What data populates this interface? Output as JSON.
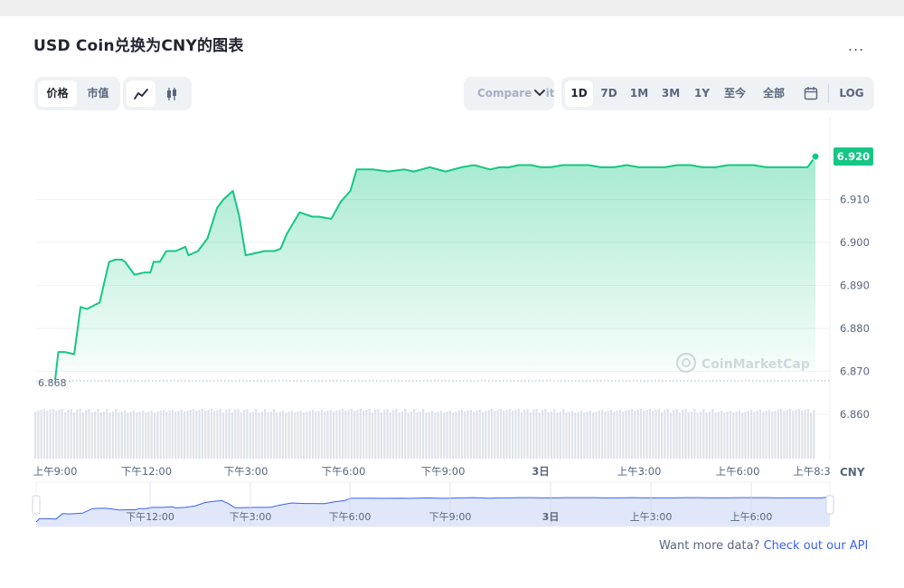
{
  "title": "USD Coin兑换为CNY的图表",
  "more_label": "...",
  "toolbar": {
    "metric_tabs": [
      "价格",
      "市值"
    ],
    "chart_type_icons": [
      "line-chart-icon",
      "candlestick-icon"
    ],
    "compare_label": "Compare with",
    "range_tabs": [
      "1D",
      "7D",
      "1M",
      "3M",
      "1Y",
      "至今",
      "全部"
    ],
    "active_range": "1D",
    "calendar_icon": "calendar-icon",
    "log_label": "LOG"
  },
  "watermark": "CoinMarketCap",
  "footer": {
    "prefix": "Want more data? ",
    "link": "Check out our API"
  },
  "colors": {
    "line": "#16c784",
    "navigator_line": "#3861fb",
    "accent": "#3861fb"
  },
  "chart_data": {
    "type": "area",
    "currency": "CNY",
    "yticks": [
      "6.920",
      "6.910",
      "6.900",
      "6.890",
      "6.880",
      "6.870",
      "6.860"
    ],
    "ylim": [
      6.855,
      6.925
    ],
    "current_value": "6.920",
    "open_value": "6.868",
    "xticks": [
      "上午9:00",
      "下午12:00",
      "下午3:00",
      "下午6:00",
      "下午9:00",
      "3日",
      "上午3:00",
      "上午6:00",
      "上午8:3"
    ],
    "navigator_xticks": [
      "下午12:00",
      "下午3:00",
      "下午6:00",
      "下午9:00",
      "3日",
      "上午3:00",
      "上午6:00"
    ],
    "x_hours": [
      0,
      0.1,
      0.3,
      0.6,
      0.8,
      1.0,
      1.4,
      1.7,
      1.9,
      2.1,
      2.2,
      2.5,
      2.8,
      3.0,
      3.1,
      3.3,
      3.5,
      3.8,
      4.1,
      4.2,
      4.5,
      4.8,
      5.1,
      5.3,
      5.6,
      5.8,
      6.0,
      6.3,
      6.6,
      6.9,
      7.1,
      7.3,
      7.7,
      8.1,
      8.3,
      8.7,
      9.0,
      9.3,
      9.5,
      10.0,
      10.5,
      11.0,
      11.3,
      11.8,
      12.3,
      12.8,
      13.2,
      13.7,
      14.0,
      14.3,
      14.6,
      15.0,
      15.3,
      15.6,
      16.0,
      16.4,
      16.8,
      17.2,
      17.6,
      18.0,
      18.4,
      18.8,
      19.2,
      19.6,
      20.0,
      20.4,
      20.8,
      21.2,
      21.6,
      22.0,
      22.4,
      22.8,
      23.2,
      23.5,
      23.7,
      23.95
    ],
    "prices": [
      6.868,
      6.8745,
      6.8745,
      6.874,
      6.885,
      6.8845,
      6.886,
      6.8955,
      6.896,
      6.896,
      6.8955,
      6.8925,
      6.893,
      6.893,
      6.8955,
      6.8955,
      6.898,
      6.898,
      6.899,
      6.897,
      6.898,
      6.901,
      6.908,
      6.91,
      6.912,
      6.906,
      6.897,
      6.8975,
      6.898,
      6.898,
      6.8985,
      6.902,
      6.907,
      6.906,
      6.906,
      6.9055,
      6.9095,
      6.912,
      6.917,
      6.917,
      6.9165,
      6.917,
      6.9165,
      6.9175,
      6.9165,
      6.9175,
      6.918,
      6.917,
      6.9175,
      6.9175,
      6.918,
      6.918,
      6.9175,
      6.9175,
      6.918,
      6.918,
      6.918,
      6.9175,
      6.9175,
      6.918,
      6.9175,
      6.9175,
      6.9175,
      6.918,
      6.918,
      6.9175,
      6.9175,
      6.918,
      6.918,
      6.918,
      6.9175,
      6.9175,
      6.9175,
      6.9175,
      6.9175,
      6.92
    ]
  }
}
